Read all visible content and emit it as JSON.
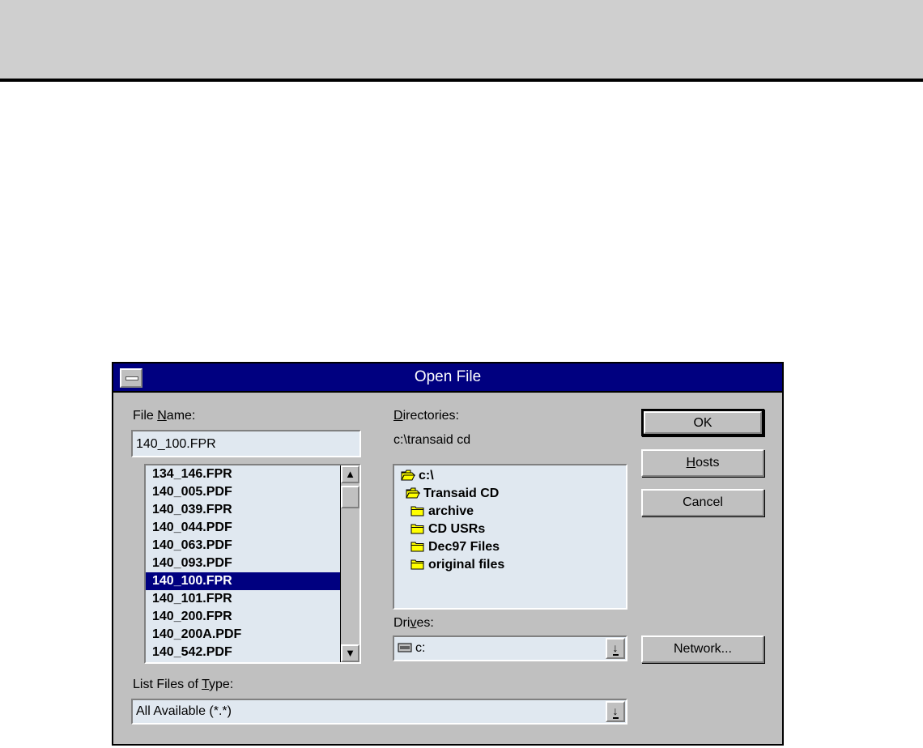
{
  "dialog": {
    "title": "Open File",
    "file_name": {
      "label_pre": "File ",
      "label_u": "N",
      "label_post": "ame:",
      "value": "140_100.FPR"
    },
    "files": [
      {
        "name": "134_146.FPR",
        "selected": false
      },
      {
        "name": "140_005.PDF",
        "selected": false
      },
      {
        "name": "140_039.FPR",
        "selected": false
      },
      {
        "name": "140_044.PDF",
        "selected": false
      },
      {
        "name": "140_063.PDF",
        "selected": false
      },
      {
        "name": "140_093.PDF",
        "selected": false
      },
      {
        "name": "140_100.FPR",
        "selected": true
      },
      {
        "name": "140_101.FPR",
        "selected": false
      },
      {
        "name": "140_200.FPR",
        "selected": false
      },
      {
        "name": "140_200A.PDF",
        "selected": false
      },
      {
        "name": "140_542.PDF",
        "selected": false
      }
    ],
    "directories": {
      "label_u": "D",
      "label_post": "irectories:",
      "current_path": "c:\\transaid cd",
      "items": [
        {
          "name": "c:\\",
          "icon": "open-folder-icon"
        },
        {
          "name": "Transaid CD",
          "icon": "open-folder-icon"
        },
        {
          "name": "archive",
          "icon": "folder-icon"
        },
        {
          "name": "CD USRs",
          "icon": "folder-icon"
        },
        {
          "name": "Dec97 Files",
          "icon": "folder-icon"
        },
        {
          "name": "original files",
          "icon": "folder-icon"
        }
      ]
    },
    "drives": {
      "label_pre": "Dri",
      "label_u": "v",
      "label_post": "es:",
      "value": "c:"
    },
    "file_type": {
      "label_pre": "List Files of ",
      "label_u": "T",
      "label_post": "ype:",
      "value": "All Available (*.*)"
    },
    "buttons": {
      "ok": "OK",
      "hosts_u": "H",
      "hosts_post": "osts",
      "cancel": "Cancel",
      "network": "Network..."
    },
    "colors": {
      "title_bar": "#000080",
      "dialog_face": "#c0c0c0",
      "field_bg": "#e0e8f0",
      "folder": "#ffff00"
    }
  }
}
